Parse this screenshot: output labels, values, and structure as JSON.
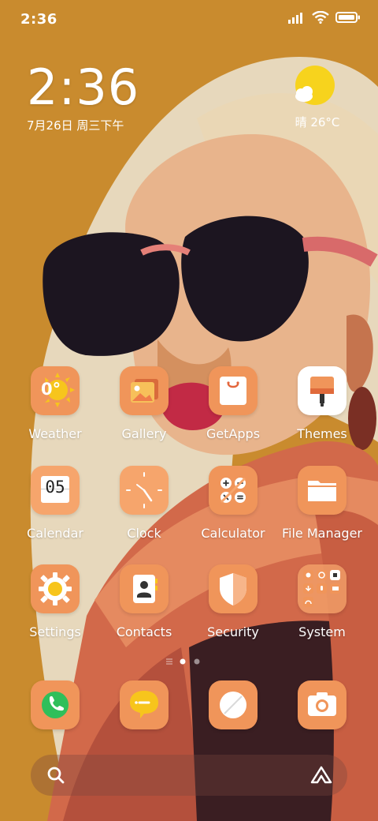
{
  "status_bar": {
    "time": "2:36",
    "icons": [
      "signal-icon",
      "wifi-icon",
      "battery-icon"
    ]
  },
  "clock_widget": {
    "time": "2:36",
    "date": "7月26日 周三下午"
  },
  "weather_widget": {
    "text": "晴 26°C",
    "icon": "sunny-cloud-icon"
  },
  "apps": [
    {
      "label": "Weather",
      "icon": "weather-icon",
      "temp": "0°"
    },
    {
      "label": "Gallery",
      "icon": "gallery-icon"
    },
    {
      "label": "GetApps",
      "icon": "getapps-icon"
    },
    {
      "label": "Themes",
      "icon": "themes-icon"
    },
    {
      "label": "Calendar",
      "icon": "calendar-icon",
      "day": "05"
    },
    {
      "label": "Clock",
      "icon": "clock-icon"
    },
    {
      "label": "Calculator",
      "icon": "calculator-icon"
    },
    {
      "label": "File Manager",
      "icon": "file-manager-icon"
    },
    {
      "label": "Settings",
      "icon": "settings-icon"
    },
    {
      "label": "Contacts",
      "icon": "contacts-icon"
    },
    {
      "label": "Security",
      "icon": "security-icon"
    },
    {
      "label": "System",
      "icon": "system-folder-icon"
    }
  ],
  "dock": [
    "phone-icon",
    "messaging-icon",
    "browser-icon",
    "camera-icon"
  ],
  "search_bar": {
    "icons": [
      "search-icon",
      "app-vault-icon"
    ]
  },
  "colors": {
    "wallpaper": "#c98b2e",
    "icon_orange": "#f0955a",
    "icon_orange_light": "#f6a56c"
  }
}
